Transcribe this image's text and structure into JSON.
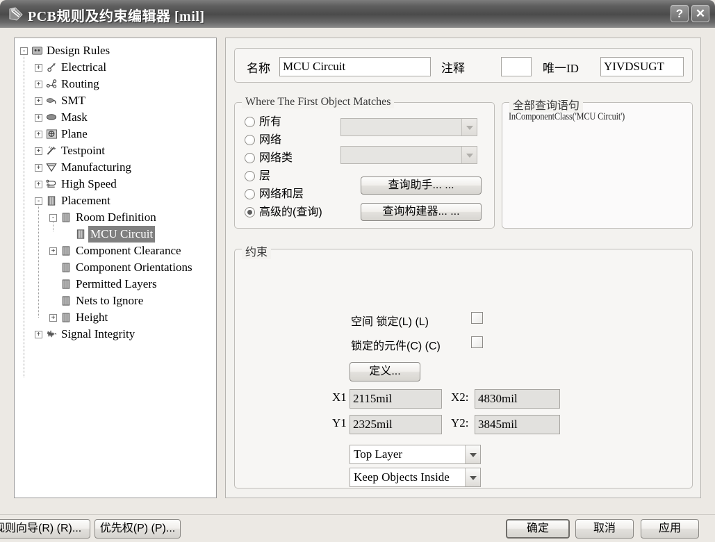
{
  "window": {
    "title": "PCB规则及约束编辑器  [mil]",
    "icon": "pcb-rules-icon",
    "help_button": "?",
    "close_button": "✕"
  },
  "tree": {
    "nodes": [
      {
        "label": "Design Rules",
        "depth": 0,
        "expander": "-",
        "icon": "design-rules-icon",
        "selected": false
      },
      {
        "label": "Electrical",
        "depth": 1,
        "expander": "+",
        "icon": "electrical-icon",
        "selected": false
      },
      {
        "label": "Routing",
        "depth": 1,
        "expander": "+",
        "icon": "routing-icon",
        "selected": false
      },
      {
        "label": "SMT",
        "depth": 1,
        "expander": "+",
        "icon": "smt-icon",
        "selected": false
      },
      {
        "label": "Mask",
        "depth": 1,
        "expander": "+",
        "icon": "mask-icon",
        "selected": false
      },
      {
        "label": "Plane",
        "depth": 1,
        "expander": "+",
        "icon": "plane-icon",
        "selected": false
      },
      {
        "label": "Testpoint",
        "depth": 1,
        "expander": "+",
        "icon": "testpoint-icon",
        "selected": false
      },
      {
        "label": "Manufacturing",
        "depth": 1,
        "expander": "+",
        "icon": "manufacturing-icon",
        "selected": false
      },
      {
        "label": "High Speed",
        "depth": 1,
        "expander": "+",
        "icon": "high-speed-icon",
        "selected": false
      },
      {
        "label": "Placement",
        "depth": 1,
        "expander": "-",
        "icon": "placement-icon",
        "selected": false
      },
      {
        "label": "Room Definition",
        "depth": 2,
        "expander": "-",
        "icon": "room-definition-icon",
        "selected": false
      },
      {
        "label": "MCU Circuit",
        "depth": 3,
        "expander": "",
        "icon": "rule-icon",
        "selected": true
      },
      {
        "label": "Component Clearance",
        "depth": 2,
        "expander": "+",
        "icon": "component-clearance-icon",
        "selected": false
      },
      {
        "label": "Component Orientations",
        "depth": 2,
        "expander": "",
        "icon": "component-orientations-icon",
        "selected": false
      },
      {
        "label": "Permitted Layers",
        "depth": 2,
        "expander": "",
        "icon": "permitted-layers-icon",
        "selected": false
      },
      {
        "label": "Nets to Ignore",
        "depth": 2,
        "expander": "",
        "icon": "nets-to-ignore-icon",
        "selected": false
      },
      {
        "label": "Height",
        "depth": 2,
        "expander": "+",
        "icon": "height-icon",
        "selected": false
      },
      {
        "label": "Signal Integrity",
        "depth": 1,
        "expander": "+",
        "icon": "signal-integrity-icon",
        "selected": false
      }
    ]
  },
  "header": {
    "name_label": "名称",
    "name_value": "MCU Circuit",
    "comment_label": "注释",
    "comment_value": "",
    "unique_id_label": "唯一ID",
    "unique_id_value": "YIVDSUGT"
  },
  "match_group": {
    "caption": "Where The First Object Matches",
    "radios": [
      {
        "label": "所有",
        "checked": false
      },
      {
        "label": "网络",
        "checked": false
      },
      {
        "label": "网络类",
        "checked": false
      },
      {
        "label": "层",
        "checked": false
      },
      {
        "label": "网络和层",
        "checked": false
      },
      {
        "label": "高级的(查询)",
        "checked": true
      }
    ],
    "combo_net_value": "",
    "combo_netclass_value": "",
    "query_helper_button": "查询助手... ...",
    "query_builder_button": "查询构建器... ..."
  },
  "query_group": {
    "caption": "全部查询语句",
    "text": "InComponentClass('MCU Circuit')"
  },
  "constraint_group": {
    "caption": "约束",
    "lock_space_label": "空间 锁定(L) (L)",
    "lock_space_checked": false,
    "lock_components_label": "锁定的元件(C) (C)",
    "lock_components_checked": false,
    "define_button": "定义...",
    "x1_label": "X1",
    "x1_value": "2115mil",
    "x2_label": "X2:",
    "x2_value": "4830mil",
    "y1_label": "Y1",
    "y1_value": "2325mil",
    "y2_label": "Y2:",
    "y2_value": "3845mil",
    "layer_combo_value": "Top Layer",
    "keep_combo_value": "Keep Objects Inside"
  },
  "footer": {
    "rule_wizard_button": "规则向导(R) (R)...",
    "priorities_button": "优先权(P) (P)...",
    "ok_button": "确定",
    "cancel_button": "取消",
    "apply_button": "应用"
  }
}
